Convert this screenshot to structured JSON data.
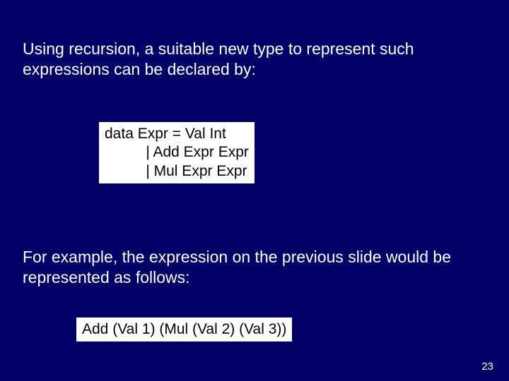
{
  "paragraph1": "Using recursion, a suitable new type to represent such expressions can be declared by:",
  "code1": "data Expr = Val Int\n          | Add Expr Expr\n          | Mul Expr Expr",
  "paragraph2": "For example, the expression on the previous slide would be represented as follows:",
  "code2": "Add (Val 1) (Mul (Val 2) (Val 3))",
  "pagenum": "23"
}
